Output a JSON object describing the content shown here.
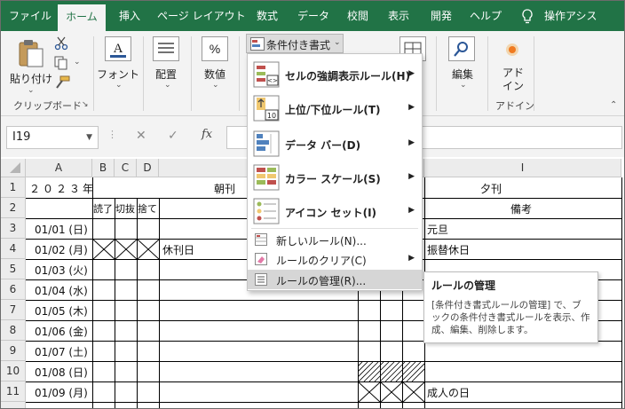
{
  "ribbon_tabs": [
    "ファイル",
    "ホーム",
    "挿入",
    "ページ レイアウト",
    "数式",
    "データ",
    "校閲",
    "表示",
    "開発",
    "ヘルプ",
    "操作アシス"
  ],
  "active_tab": "ホーム",
  "ribbon": {
    "paste_label": "貼り付け",
    "clipboard_group": "クリップボード",
    "font_label": "フォント",
    "alignment_label": "配置",
    "number_label": "数値",
    "cond_format_label": "条件付き書式",
    "edit_label": "編集",
    "addin_label": "アド\nイン",
    "addin_line1": "アド",
    "addin_line2": "イン",
    "addin_group": "アドイン"
  },
  "formula_bar": {
    "name_box": "I19",
    "fx": "fx"
  },
  "grid": {
    "columns": [
      "A",
      "B",
      "C",
      "D",
      "I"
    ],
    "rows": [
      "1",
      "2",
      "3",
      "4",
      "5",
      "6",
      "7",
      "8",
      "9",
      "10",
      "11"
    ],
    "a1": "２０２３年",
    "morning_header": "朝刊",
    "evening_header": "夕刊",
    "b2": "読了",
    "c2": "切抜",
    "d2": "捨て",
    "remarks_header": "備考",
    "dates": [
      "01/01 (日)",
      "01/02 (月)",
      "01/03 (火)",
      "01/04 (水)",
      "01/05 (木)",
      "01/06 (金)",
      "01/07 (土)",
      "01/08 (日)",
      "01/09 (月)"
    ],
    "e4_note": "休刊日",
    "i3": "元旦",
    "i4": "振替休日",
    "i11": "成人の日"
  },
  "cond_menu": {
    "items": [
      {
        "label": "セルの強調表示ルール(H)",
        "icon": "highlight-rules-icon"
      },
      {
        "label": "上位/下位ルール(T)",
        "icon": "top-bottom-icon"
      },
      {
        "label": "データ バー(D)",
        "icon": "data-bar-icon"
      },
      {
        "label": "カラー スケール(S)",
        "icon": "color-scale-icon"
      },
      {
        "label": "アイコン セット(I)",
        "icon": "icon-set-icon"
      }
    ],
    "new_rule": "新しいルール(N)...",
    "clear_rule": "ルールのクリア(C)",
    "manage_rule": "ルールの管理(R)..."
  },
  "tooltip": {
    "title": "ルールの管理",
    "body": "[条件付き書式ルールの管理] で、ブックの条件付き書式ルールを表示、作成、編集、削除します。"
  },
  "colors": {
    "excel_green": "#217346",
    "ribbon_bg": "#f3f3f3",
    "menu_highlight": "#d6d6d6"
  }
}
